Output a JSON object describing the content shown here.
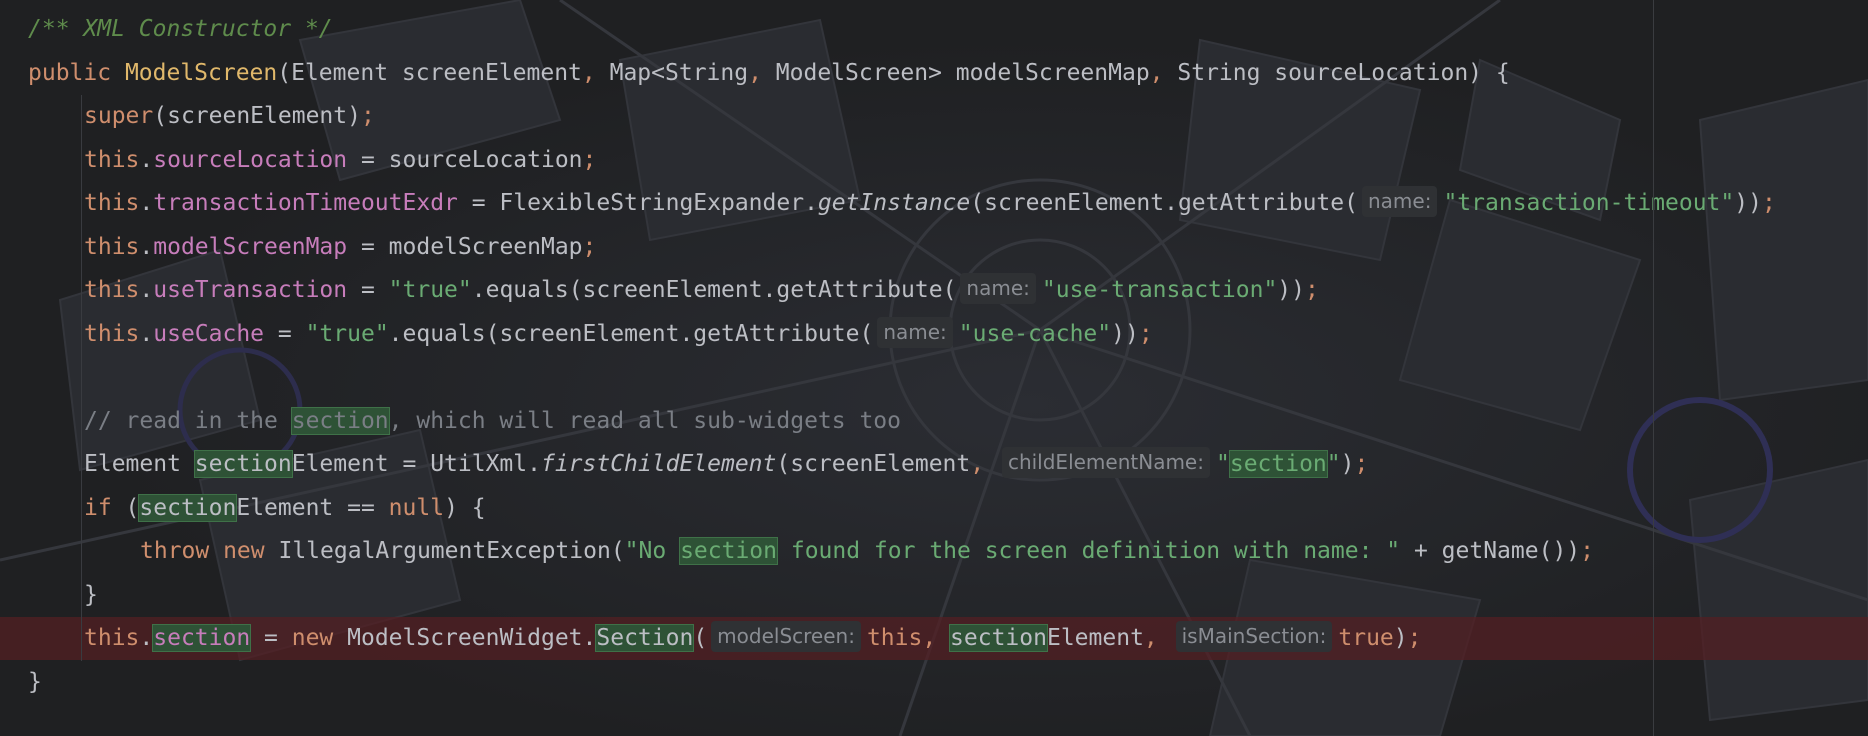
{
  "editor": {
    "lines": [
      {
        "segments": [
          {
            "t": "/** XML Constructor */",
            "c": "doc"
          }
        ]
      },
      {
        "segments": [
          {
            "t": "public ",
            "c": "kw"
          },
          {
            "t": "ModelScreen",
            "c": "fn"
          },
          {
            "t": "(Element screenElement",
            "c": ""
          },
          {
            "t": ", ",
            "c": "semi"
          },
          {
            "t": "Map<String",
            "c": ""
          },
          {
            "t": ", ",
            "c": "semi"
          },
          {
            "t": "ModelScreen> modelScreenMap",
            "c": ""
          },
          {
            "t": ", ",
            "c": "semi"
          },
          {
            "t": "String sourceLocation) {",
            "c": ""
          }
        ]
      },
      {
        "indent": 1,
        "segments": [
          {
            "t": "super",
            "c": "kw"
          },
          {
            "t": "(screenElement)",
            "c": ""
          },
          {
            "t": ";",
            "c": "semi"
          }
        ]
      },
      {
        "indent": 1,
        "segments": [
          {
            "t": "this",
            "c": "kw"
          },
          {
            "t": ".",
            "c": ""
          },
          {
            "t": "sourceLocation",
            "c": "field"
          },
          {
            "t": " = sourceLocation",
            "c": ""
          },
          {
            "t": ";",
            "c": "semi"
          }
        ]
      },
      {
        "indent": 1,
        "segments": [
          {
            "t": "this",
            "c": "kw"
          },
          {
            "t": ".",
            "c": ""
          },
          {
            "t": "transactionTimeoutExdr",
            "c": "field"
          },
          {
            "t": " = FlexibleStringExpander.",
            "c": ""
          },
          {
            "t": "getInstance",
            "c": "it"
          },
          {
            "t": "(screenElement.getAttribute(",
            "c": ""
          },
          {
            "hint": "name:"
          },
          {
            "t": "\"transaction-timeout\"",
            "c": "str"
          },
          {
            "t": "))",
            "c": ""
          },
          {
            "t": ";",
            "c": "semi"
          }
        ]
      },
      {
        "indent": 1,
        "segments": [
          {
            "t": "this",
            "c": "kw"
          },
          {
            "t": ".",
            "c": ""
          },
          {
            "t": "modelScreenMap",
            "c": "field"
          },
          {
            "t": " = modelScreenMap",
            "c": ""
          },
          {
            "t": ";",
            "c": "semi"
          }
        ]
      },
      {
        "indent": 1,
        "segments": [
          {
            "t": "this",
            "c": "kw"
          },
          {
            "t": ".",
            "c": ""
          },
          {
            "t": "useTransaction",
            "c": "field"
          },
          {
            "t": " = ",
            "c": ""
          },
          {
            "t": "\"true\"",
            "c": "str"
          },
          {
            "t": ".equals(screenElement.getAttribute(",
            "c": ""
          },
          {
            "hint": "name:"
          },
          {
            "t": "\"use-transaction\"",
            "c": "str"
          },
          {
            "t": "))",
            "c": ""
          },
          {
            "t": ";",
            "c": "semi"
          }
        ]
      },
      {
        "indent": 1,
        "segments": [
          {
            "t": "this",
            "c": "kw"
          },
          {
            "t": ".",
            "c": ""
          },
          {
            "t": "useCache",
            "c": "field"
          },
          {
            "t": " = ",
            "c": ""
          },
          {
            "t": "\"true\"",
            "c": "str"
          },
          {
            "t": ".equals(screenElement.getAttribute(",
            "c": ""
          },
          {
            "hint": "name:"
          },
          {
            "t": "\"use-cache\"",
            "c": "str"
          },
          {
            "t": "))",
            "c": ""
          },
          {
            "t": ";",
            "c": "semi"
          }
        ]
      },
      {
        "segments": []
      },
      {
        "indent": 1,
        "segments": [
          {
            "t": "// read in the ",
            "c": "cmt"
          },
          {
            "t": "section",
            "c": "cmt usage"
          },
          {
            "t": ", which will read all sub-widgets too",
            "c": "cmt"
          }
        ]
      },
      {
        "indent": 1,
        "segments": [
          {
            "t": "Element ",
            "c": ""
          },
          {
            "t": "section",
            "c": "usage"
          },
          {
            "t": "Element = UtilXml.",
            "c": ""
          },
          {
            "t": "firstChildElement",
            "c": "it"
          },
          {
            "t": "(screenElement",
            "c": ""
          },
          {
            "t": ", ",
            "c": "semi"
          },
          {
            "hint": "childElementName:"
          },
          {
            "t": "\"",
            "c": "str"
          },
          {
            "t": "section",
            "c": "str usage"
          },
          {
            "t": "\"",
            "c": "str"
          },
          {
            "t": ")",
            "c": ""
          },
          {
            "t": ";",
            "c": "semi"
          }
        ]
      },
      {
        "indent": 1,
        "segments": [
          {
            "t": "if ",
            "c": "kw"
          },
          {
            "t": "(",
            "c": ""
          },
          {
            "t": "section",
            "c": "usage"
          },
          {
            "t": "Element == ",
            "c": ""
          },
          {
            "t": "null",
            "c": "kw"
          },
          {
            "t": ") {",
            "c": ""
          }
        ]
      },
      {
        "indent": 2,
        "segments": [
          {
            "t": "throw new ",
            "c": "kw"
          },
          {
            "t": "IllegalArgumentException(",
            "c": ""
          },
          {
            "t": "\"No ",
            "c": "str"
          },
          {
            "t": "section",
            "c": "str usage"
          },
          {
            "t": " found for the screen definition with name: \"",
            "c": "str"
          },
          {
            "t": " + getName())",
            "c": ""
          },
          {
            "t": ";",
            "c": "semi"
          }
        ]
      },
      {
        "indent": 1,
        "segments": [
          {
            "t": "}",
            "c": ""
          }
        ]
      },
      {
        "indent": 1,
        "highlight": true,
        "segments": [
          {
            "t": "this",
            "c": "kw"
          },
          {
            "t": ".",
            "c": ""
          },
          {
            "t": "section",
            "c": "field usage"
          },
          {
            "t": " = ",
            "c": ""
          },
          {
            "t": "new ",
            "c": "kw"
          },
          {
            "t": "ModelScreenWidget.",
            "c": ""
          },
          {
            "t": "Section",
            "c": "usage"
          },
          {
            "t": "(",
            "c": ""
          },
          {
            "hint": "modelScreen:"
          },
          {
            "t": "this",
            "c": "kw"
          },
          {
            "t": ", ",
            "c": "semi"
          },
          {
            "t": "section",
            "c": "usage"
          },
          {
            "t": "Element",
            "c": ""
          },
          {
            "t": ", ",
            "c": "semi"
          },
          {
            "hint": "isMainSection:"
          },
          {
            "t": "true",
            "c": "kw"
          },
          {
            "t": ")",
            "c": ""
          },
          {
            "t": ";",
            "c": "semi"
          }
        ]
      },
      {
        "segments": [
          {
            "t": "}",
            "c": ""
          }
        ]
      }
    ]
  }
}
